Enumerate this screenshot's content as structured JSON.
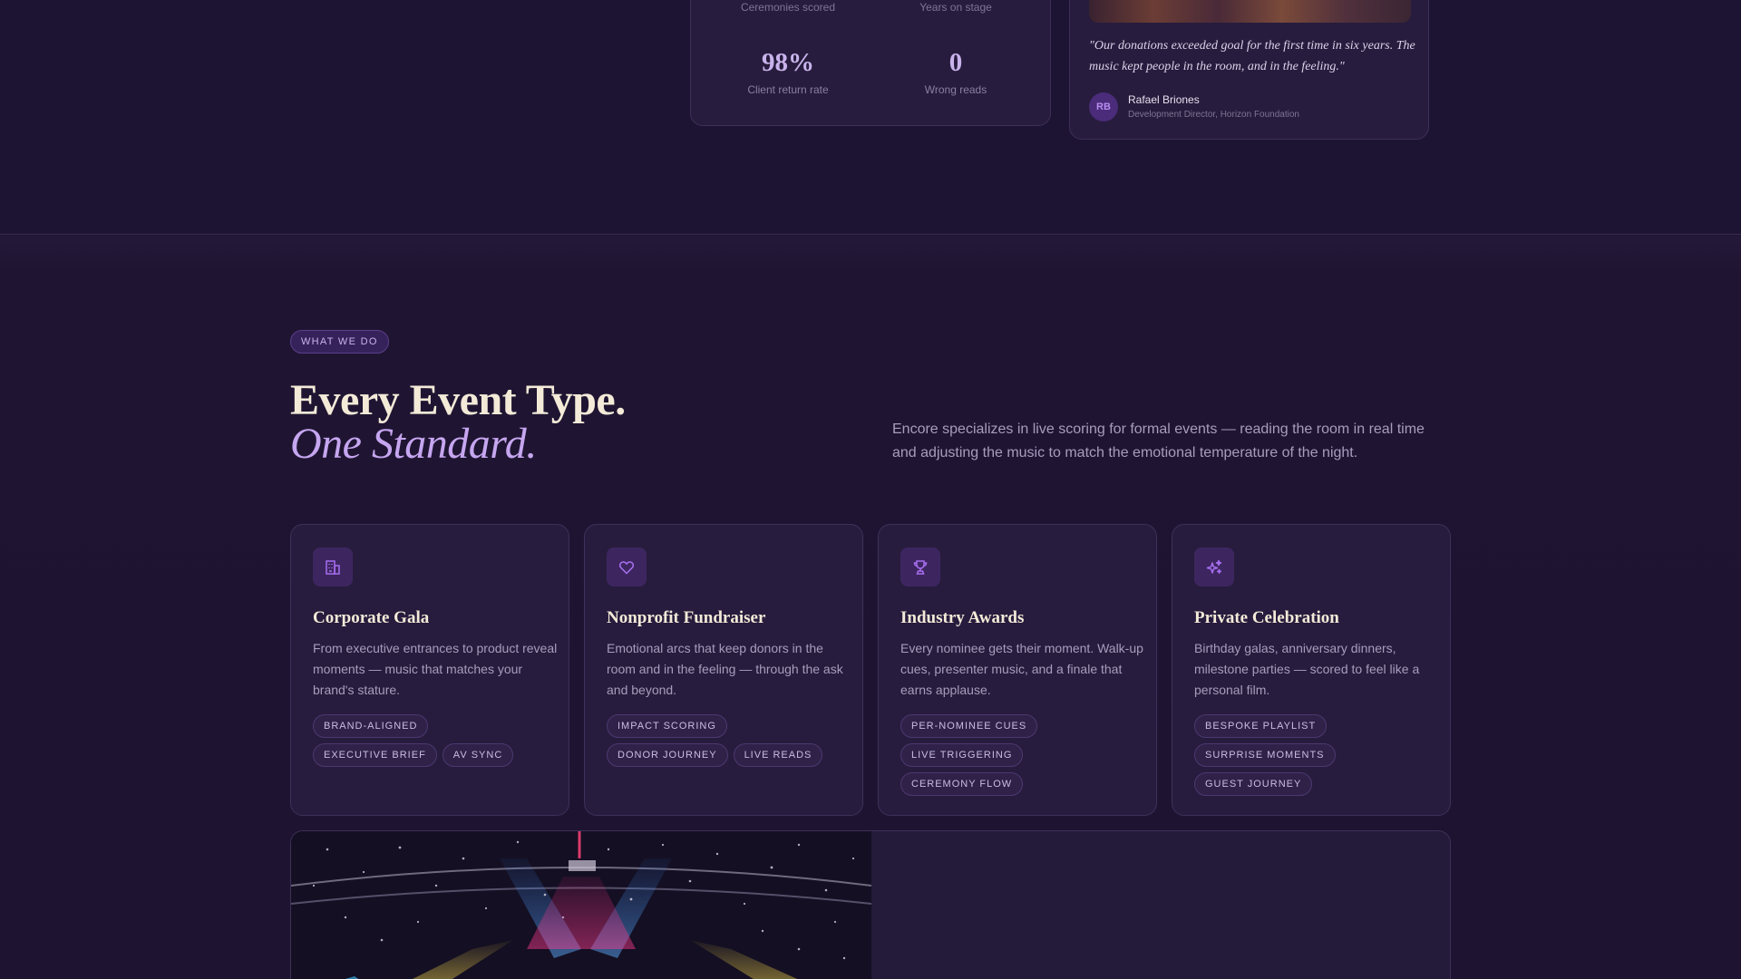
{
  "stats": {
    "top_labels": [
      "Ceremonies scored",
      "Years on stage"
    ],
    "items": [
      {
        "value": "98%",
        "label": "Client return rate"
      },
      {
        "value": "0",
        "label": "Wrong reads"
      }
    ]
  },
  "testimonial": {
    "quote": "\"Our donations exceeded goal for the first time in six years. The music kept people in the room, and in the feeling.\"",
    "initials": "RB",
    "name": "Rafael Briones",
    "role": "Development Director, Horizon Foundation"
  },
  "section": {
    "eyebrow": "WHAT WE DO",
    "title_line1": "Every Event Type.",
    "title_line2": "One Standard.",
    "intro": "Encore specializes in live scoring for formal events — reading the room in real time and adjusting the music to match the emotional temperature of the night."
  },
  "cards": [
    {
      "icon": "building-icon",
      "title": "Corporate Gala",
      "desc": "From executive entrances to product reveal moments — music that matches your brand's stature.",
      "tags": [
        "BRAND-ALIGNED",
        "EXECUTIVE BRIEF",
        "AV SYNC"
      ]
    },
    {
      "icon": "heart-icon",
      "title": "Nonprofit Fundraiser",
      "desc": "Emotional arcs that keep donors in the room and in the feeling — through the ask and beyond.",
      "tags": [
        "IMPACT SCORING",
        "DONOR JOURNEY",
        "LIVE READS"
      ]
    },
    {
      "icon": "trophy-icon",
      "title": "Industry Awards",
      "desc": "Every nominee gets their moment. Walk-up cues, presenter music, and a finale that earns applause.",
      "tags": [
        "PER-NOMINEE CUES",
        "LIVE TRIGGERING",
        "CEREMONY FLOW"
      ]
    },
    {
      "icon": "sparkles-icon",
      "title": "Private Celebration",
      "desc": "Birthday galas, anniversary dinners, milestone parties — scored to feel like a personal film.",
      "tags": [
        "BESPOKE PLAYLIST",
        "SURPRISE MOMENTS",
        "GUEST JOURNEY"
      ]
    }
  ],
  "colors": {
    "background": "#1c1230",
    "card": "#271c3d",
    "accent": "#c6a6f0",
    "cream": "#f3ead8"
  }
}
